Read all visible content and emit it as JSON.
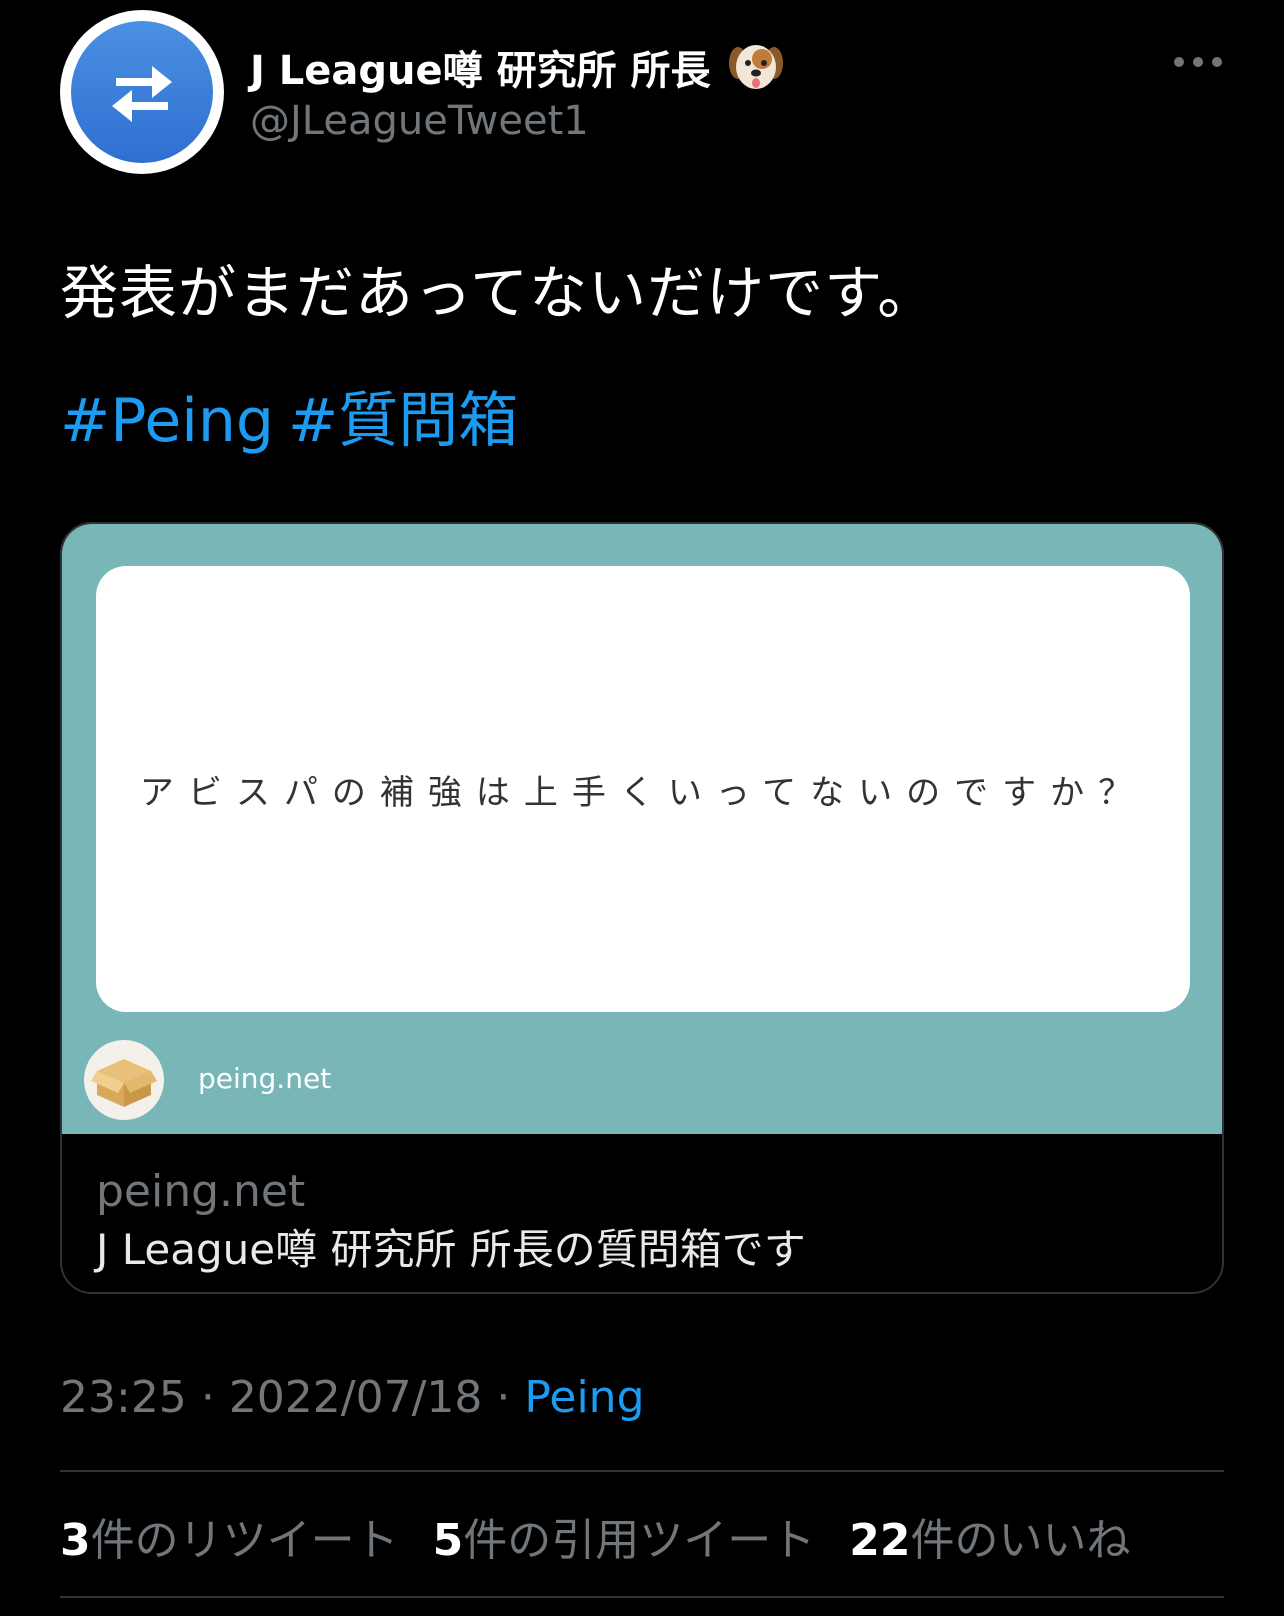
{
  "author": {
    "display_name": "J League噂 研究所 所長",
    "handle": "@JLeagueTweet1",
    "avatar_icon": "swap-arrows-icon",
    "name_emoji": "dog-face-emoji"
  },
  "tweet": {
    "text": "発表がまだあってないだけです。",
    "hashtags": [
      "#Peing",
      "#質問箱"
    ]
  },
  "card": {
    "question": "アビスパの補強は上手くいってないのですか？",
    "image_domain": "peing.net",
    "domain": "peing.net",
    "title": "J League噂 研究所 所長の質問箱です",
    "accent_color": "#78b6b8"
  },
  "meta": {
    "time": "23:25",
    "separator": "·",
    "date": "2022/07/18",
    "source": "Peing"
  },
  "stats": [
    {
      "count": "3",
      "label": "件のリツイート"
    },
    {
      "count": "5",
      "label": "件の引用ツイート"
    },
    {
      "count": "22",
      "label": "件のいいね"
    }
  ],
  "colors": {
    "background": "#000000",
    "link_blue": "#1d9bf0",
    "muted_gray": "#71767b"
  }
}
